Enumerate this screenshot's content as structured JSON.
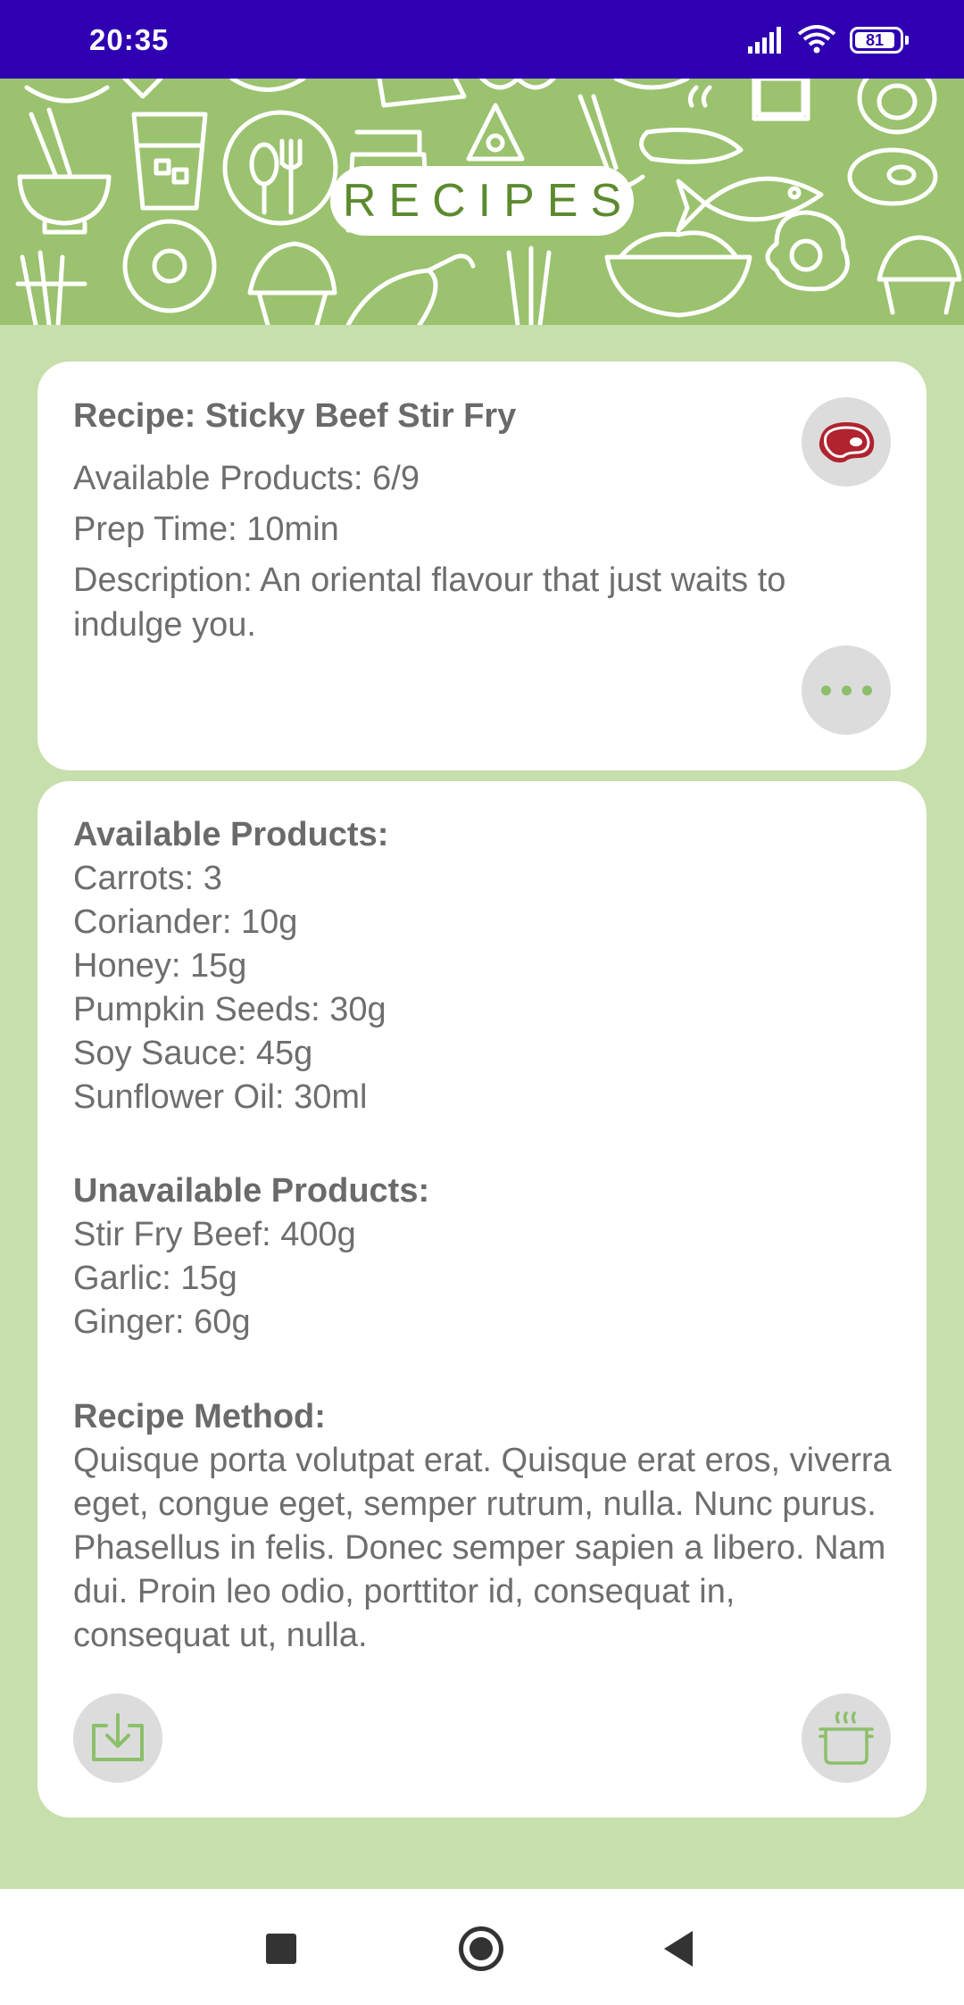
{
  "status_bar": {
    "time": "20:35",
    "battery": "81"
  },
  "banner": {
    "title": "RECIPES"
  },
  "recipe": {
    "title": "Recipe: Sticky Beef Stir Fry",
    "available": "Available Products: 6/9",
    "prep_time": "Prep Time: 10min",
    "description": "Description: An oriental flavour that just waits to indulge you.",
    "category_icon": "meat-steak-icon"
  },
  "details": {
    "available_heading": "Available Products:",
    "available_items": [
      "Carrots: 3",
      "Coriander: 10g",
      "Honey: 15g",
      "Pumpkin Seeds: 30g",
      "Soy Sauce: 45g",
      "Sunflower Oil: 30ml"
    ],
    "unavailable_heading": "Unavailable Products:",
    "unavailable_items": [
      "Stir Fry Beef: 400g",
      "Garlic: 15g",
      "Ginger: 60g"
    ],
    "method_heading": "Recipe Method:",
    "method_text": "Quisque porta volutpat erat. Quisque erat eros, viverra eget, congue eget, semper rutrum, nulla. Nunc purus. Phasellus in felis. Donec semper sapien a libero. Nam dui. Proin leo odio, porttitor id, consequat in, consequat ut, nulla."
  },
  "colors": {
    "status_bar": "#2f00b2",
    "banner_green": "#9bc26f",
    "page_background": "#c7dfac",
    "accent_green": "#8bc06a",
    "meat_red": "#b0232f"
  },
  "icons": {
    "more": "more-dots-icon",
    "download": "download-icon",
    "cook": "cooking-pot-icon"
  }
}
